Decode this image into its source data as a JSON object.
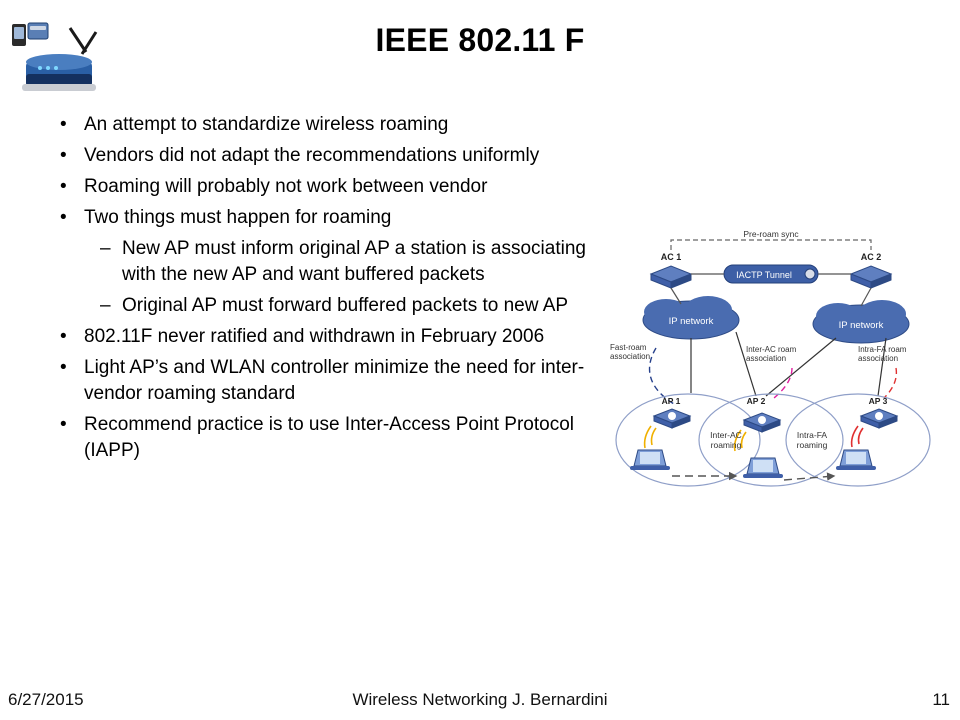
{
  "slide": {
    "title": "IEEE 802.11 F",
    "bullets": [
      {
        "level": 1,
        "marker": "•",
        "text": "An attempt to standardize wireless roaming"
      },
      {
        "level": 1,
        "marker": "•",
        "text": "Vendors did not  adapt the recommendations uniformly"
      },
      {
        "level": 1,
        "marker": "•",
        "text": "Roaming will probably not work between vendor"
      },
      {
        "level": 1,
        "marker": "•",
        "text": "Two things must happen for roaming"
      },
      {
        "level": 2,
        "marker": "–",
        "text": "New AP must inform original AP a station is associating with the new AP and want buffered packets"
      },
      {
        "level": 2,
        "marker": "–",
        "text": "Original AP must forward buffered packets to new AP"
      },
      {
        "level": 1,
        "marker": "•",
        "text": "802.11F never ratified and withdrawn in February 2006"
      },
      {
        "level": 1,
        "marker": "•",
        "text": "Light AP’s and WLAN controller minimize the need for inter-vendor roaming standard"
      },
      {
        "level": 1,
        "marker": "•",
        "text": "Recommend practice is to use Inter-Access Point Protocol (IAPP)"
      }
    ],
    "footer": {
      "date": "6/27/2015",
      "center": "Wireless Networking   J. Bernardini",
      "page": "11"
    },
    "figure": {
      "labels": {
        "pre_roam_sync": "Pre-roam sync",
        "ac1": "AC 1",
        "ac2": "AC 2",
        "iactp_tunnel": "IACTP Tunnel",
        "ip_network_left": "IP network",
        "ip_network_right": "IP network",
        "fast_roam": "Fast-roam\nassociation",
        "inter_ac_roam": "Inter-AC roam\nassociation",
        "intra_fa_roam": "Intra-FA roam\nassociation",
        "ap1": "AP 1",
        "ap2": "AP 2",
        "ap3": "AP 3",
        "inter_ac_roaming": "Inter-AC\nroaming",
        "intra_fa_roaming": "Intra-FA\nroaming"
      },
      "colors": {
        "device_blue": "#3f5fa8",
        "cloud_fill": "#dfe6f5",
        "cloud_stroke": "#8f9fc8",
        "tunnel_fill": "#3d5fa6",
        "accent_magenta": "#e020a0",
        "accent_red": "#e03030",
        "accent_navy": "#26408b"
      }
    },
    "logo": {
      "name": "wireless-router-photo",
      "colors": {
        "body": "#2a5fa5",
        "body_dark": "#14305f",
        "silver": "#c9ccd2",
        "antenna": "#1a1a1a"
      }
    }
  }
}
